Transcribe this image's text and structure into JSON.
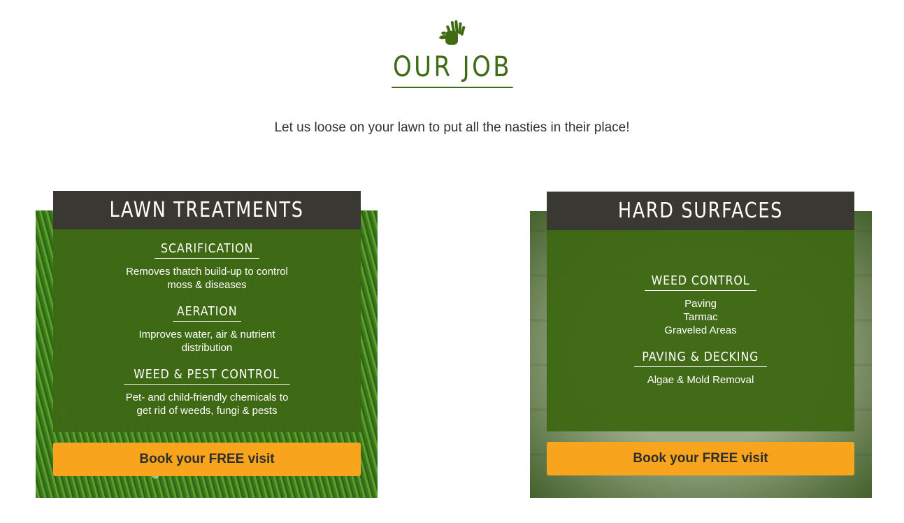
{
  "header": {
    "icon": "hands-icon",
    "title": "OUR JOB",
    "subtitle": "Let us loose on your lawn to put all the nasties in their place!"
  },
  "colors": {
    "brand_green": "#3e6b14",
    "header_dark": "#3a3833",
    "button_orange": "#f8a51d"
  },
  "cards": [
    {
      "title": "LAWN TREATMENTS",
      "services": [
        {
          "title": "SCARIFICATION",
          "desc": [
            "Removes thatch build-up to control",
            "moss & diseases"
          ]
        },
        {
          "title": "AERATION",
          "desc": [
            "Improves water, air & nutrient",
            "distribution"
          ]
        },
        {
          "title": "WEED & PEST CONTROL",
          "desc": [
            "Pet- and child-friendly chemicals to",
            "get rid of weeds, fungi & pests"
          ]
        }
      ],
      "button": "Book your FREE visit"
    },
    {
      "title": "HARD SURFACES",
      "services": [
        {
          "title": "WEED CONTROL",
          "desc": [
            "Paving",
            "Tarmac",
            "Graveled Areas"
          ]
        },
        {
          "title": "PAVING & DECKING",
          "desc": [
            "Algae & Mold Removal"
          ]
        }
      ],
      "button": "Book your FREE visit"
    }
  ]
}
